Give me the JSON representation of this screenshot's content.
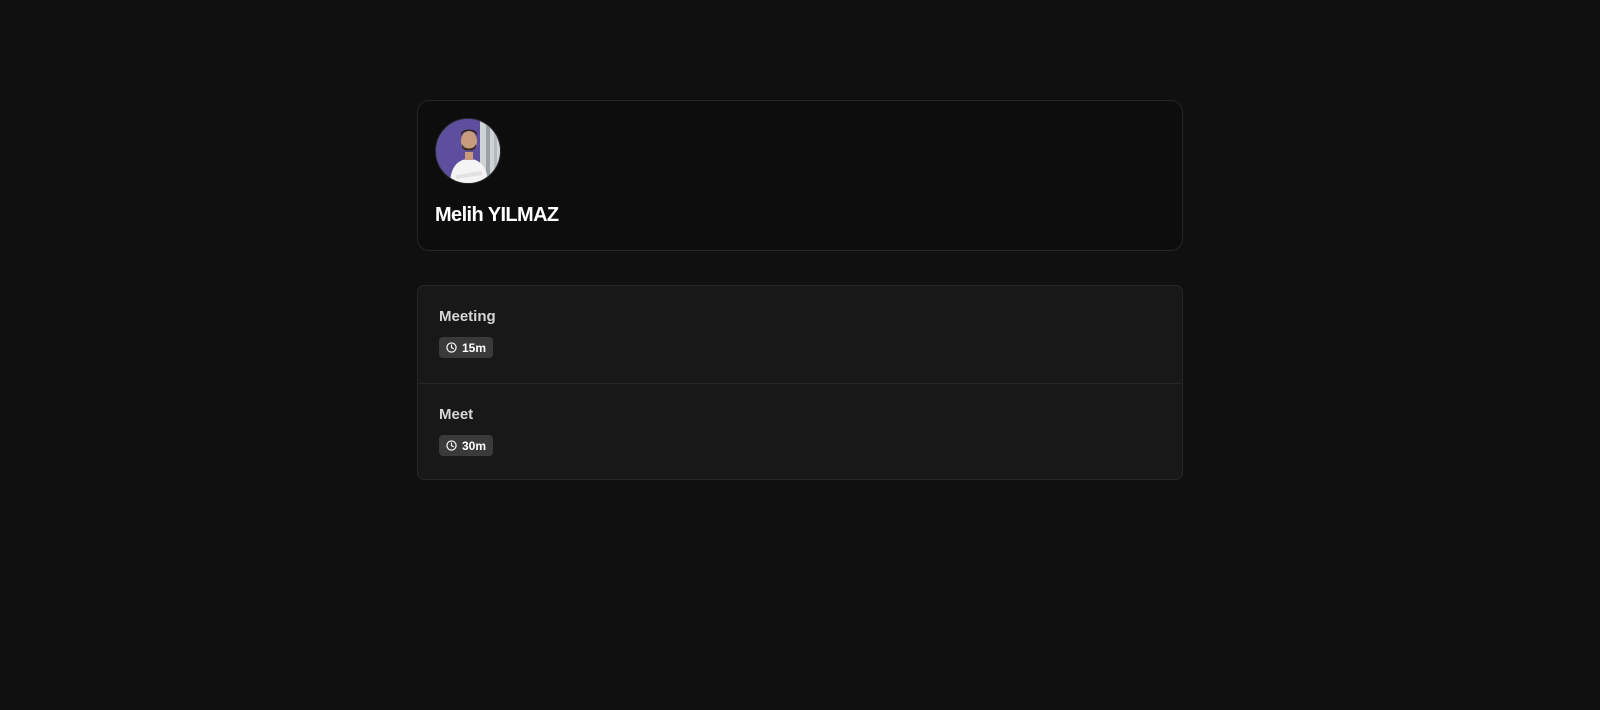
{
  "profile": {
    "name": "Melih YILMAZ",
    "avatar_icon": "user-avatar-photo"
  },
  "events": [
    {
      "title": "Meeting",
      "duration": "15m",
      "icon": "clock-icon"
    },
    {
      "title": "Meet",
      "duration": "30m",
      "icon": "clock-icon"
    }
  ],
  "colors": {
    "background": "#101010",
    "card_border": "#262626",
    "list_background": "#181818",
    "badge_background": "#3a3a3a",
    "avatar_background": "#6a5aa8"
  }
}
